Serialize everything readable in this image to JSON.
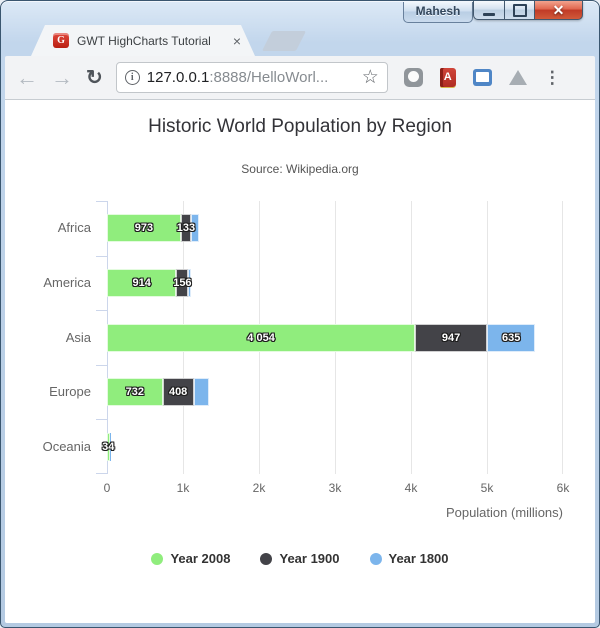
{
  "titlebar": {
    "profile_label": "Mahesh",
    "close_glyph": "✕"
  },
  "tab": {
    "favicon_letter": "G",
    "title": "GWT HighCharts Tutorial",
    "close_glyph": "×"
  },
  "toolbar": {
    "back_glyph": "←",
    "forward_glyph": "→",
    "reload_glyph": "↻",
    "info_glyph": "i",
    "url_host": "127.0.0.1",
    "url_rest": ":8888/HelloWorl...",
    "star_glyph": "☆",
    "dictionary_letter": "A",
    "menu_glyph": "⋮"
  },
  "chart_data": {
    "type": "bar",
    "stacked": true,
    "title": "Historic World Population by Region",
    "subtitle": "Source: Wikipedia.org",
    "categories": [
      "Africa",
      "America",
      "Asia",
      "Europe",
      "Oceania"
    ],
    "series": [
      {
        "name": "Year 2008",
        "color": "#90ed7d",
        "values": [
          973,
          914,
          4054,
          732,
          34
        ]
      },
      {
        "name": "Year 1900",
        "color": "#434348",
        "values": [
          133,
          156,
          947,
          408,
          6
        ]
      },
      {
        "name": "Year 1800",
        "color": "#7cb5ec",
        "values": [
          107,
          31,
          635,
          203,
          2
        ]
      }
    ],
    "segment_labels": [
      [
        "973",
        "133",
        ""
      ],
      [
        "914",
        "156",
        ""
      ],
      [
        "4 054",
        "947",
        "635"
      ],
      [
        "732",
        "408",
        ""
      ],
      [
        "34",
        "",
        ""
      ]
    ],
    "xlabel": "Population (millions)",
    "x_ticks": [
      "0",
      "1k",
      "2k",
      "3k",
      "4k",
      "5k",
      "6k"
    ],
    "xlim": [
      0,
      6000
    ],
    "grid": true,
    "legend_position": "bottom"
  }
}
